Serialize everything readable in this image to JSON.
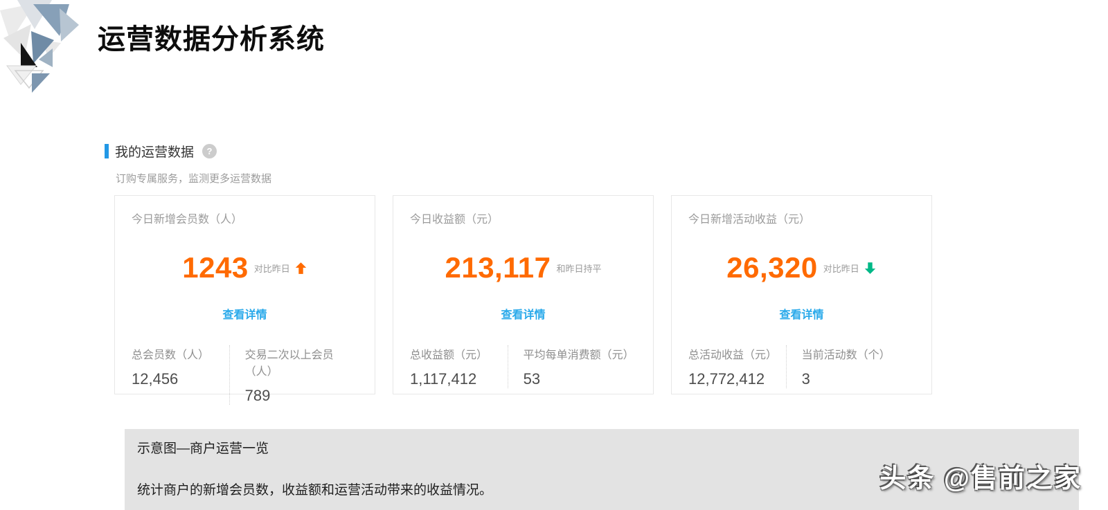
{
  "page": {
    "title": "运营数据分析系统"
  },
  "section": {
    "title": "我的运营数据",
    "help_glyph": "?",
    "subtitle": "订购专属服务，监测更多运营数据"
  },
  "cards": [
    {
      "title": "今日新增会员数（人）",
      "value": "1243",
      "trend_label": "对比昨日",
      "trend": "up",
      "link": "查看详情",
      "stats": [
        {
          "label": "总会员数（人）",
          "value": "12,456"
        },
        {
          "label": "交易二次以上会员（人）",
          "value": "789"
        }
      ]
    },
    {
      "title": "今日收益额（元）",
      "value": "213,117",
      "trend_label": "和昨日持平",
      "trend": "flat",
      "link": "查看详情",
      "stats": [
        {
          "label": "总收益额（元）",
          "value": "1,117,412"
        },
        {
          "label": "平均每单消费额（元）",
          "value": "53"
        }
      ]
    },
    {
      "title": "今日新增活动收益（元）",
      "value": "26,320",
      "trend_label": "对比昨日",
      "trend": "down",
      "link": "查看详情",
      "stats": [
        {
          "label": "总活动收益（元）",
          "value": "12,772,412"
        },
        {
          "label": "当前活动数（个）",
          "value": "3"
        }
      ]
    }
  ],
  "caption": {
    "line1": "示意图—商户运营一览",
    "line2": "统计商户的新增会员数，收益额和运营活动带来的收益情况。"
  },
  "watermark": "头条 @售前之家",
  "colors": {
    "accent_orange": "#ff6a00",
    "link_blue": "#29a9ea",
    "section_bar_blue": "#2298e6",
    "trend_up": "#ff6a00",
    "trend_down": "#00b887",
    "caption_bg": "#e3e3e3"
  }
}
